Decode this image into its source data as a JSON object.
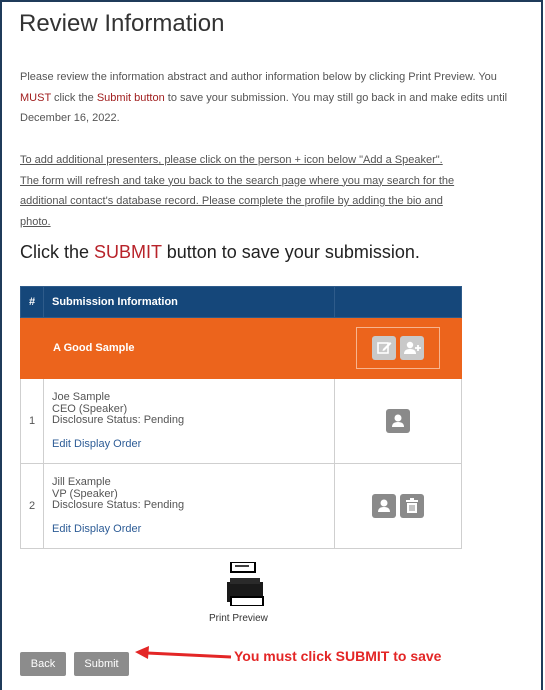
{
  "page": {
    "title": "Review Information",
    "intro_part1": "Please review the information abstract and author information below by clicking Print Preview. You ",
    "intro_must": "MUST",
    "intro_part2": " click the ",
    "intro_submit_button": "Submit button",
    "intro_part3": " to save your submission. You may still go back in and make edits until December 16, 2022.",
    "note": "To add additional presenters, please click on the person + icon below \"Add a Speaker\". The form will refresh and take you back to the search page where you may search for the additional contact's database record. Please complete the profile by adding the bio and photo.",
    "click_prefix": "Click the ",
    "click_submit": "SUBMIT",
    "click_suffix": " button to save your submission."
  },
  "table": {
    "col_num": "#",
    "col_info": "Submission Information",
    "submission_title": "A Good Sample",
    "rows": [
      {
        "num": "1",
        "name": "Joe Sample",
        "role": "CEO (Speaker)",
        "status": "Disclosure Status: Pending",
        "edit": "Edit Display Order"
      },
      {
        "num": "2",
        "name": "Jill Example",
        "role": "VP (Speaker)",
        "status": "Disclosure Status: Pending",
        "edit": "Edit Display Order"
      }
    ]
  },
  "print": {
    "label": "Print Preview"
  },
  "buttons": {
    "back": "Back",
    "submit": "Submit"
  },
  "annotation": "You must click SUBMIT to save",
  "colors": {
    "header_blue": "#15477a",
    "orange": "#ec641c",
    "annotation_red": "#e32626"
  }
}
